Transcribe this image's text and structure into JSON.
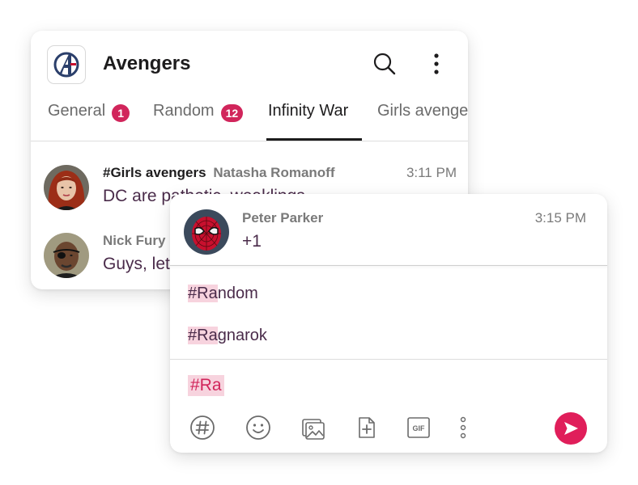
{
  "app": {
    "title": "Avengers",
    "logo_icon": "avengers-a-logo-icon"
  },
  "header": {
    "search_icon": "search-icon",
    "more_icon": "more-vertical-icon"
  },
  "tabs": [
    {
      "label": "General",
      "badge": "1"
    },
    {
      "label": "Random",
      "badge": "12"
    },
    {
      "label": "Infinity War",
      "badge": null,
      "active": true
    },
    {
      "label": "Girls avengers",
      "badge": null
    }
  ],
  "messages": [
    {
      "channel": "#Girls avengers",
      "author": "Natasha Romanoff",
      "time": "3:11 PM",
      "text": "DC are pathetic, weaklings"
    },
    {
      "author": "Nick Fury",
      "text": "Guys, let's meet"
    }
  ],
  "thread": {
    "author": "Peter Parker",
    "time": "3:15 PM",
    "text": "+1"
  },
  "suggestions": [
    {
      "match": "#Ra",
      "rest": "ndom"
    },
    {
      "match": "#Ra",
      "rest": "gnarok"
    }
  ],
  "compose": {
    "value": "#Ra"
  },
  "toolbar": {
    "icons": [
      "hashtag-icon",
      "emoji-icon",
      "image-icon",
      "attach-file-icon",
      "gif-icon",
      "more-vertical-icon"
    ],
    "gif_label": "GIF",
    "send_icon": "send-icon"
  },
  "colors": {
    "accent": "#e01e5a",
    "badge": "#d1255b",
    "highlight": "#f7d3de",
    "text": "#1d1c1d"
  }
}
